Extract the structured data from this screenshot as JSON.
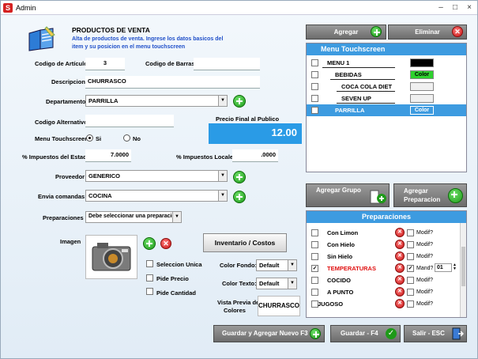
{
  "window": {
    "title": "Admin",
    "min": "–",
    "max": "□",
    "close": "×"
  },
  "header": {
    "title": "PRODUCTOS DE VENTA",
    "subtitle_line1": "Alta de productos de venta. Ingrese los datos basicos del",
    "subtitle_line2": "item y su posicion en el menu touchscreen"
  },
  "form": {
    "codigo_articulo_label": "Codigo de Artículo",
    "codigo_articulo_value": "3",
    "codigo_barras_label": "Codigo de Barras",
    "codigo_barras_value": "",
    "descripcion_label": "Descripcion",
    "descripcion_value": "CHURRASCO",
    "departamento_label": "Departamento",
    "departamento_value": "PARRILLA",
    "codigo_alternativo_label": "Codigo Alternativo",
    "codigo_alternativo_value": "",
    "precio_label": "Precio Final al Publico",
    "precio_value": "12.00",
    "menu_touch_label": "Menu Touchscreen",
    "si_label": "Si",
    "no_label": "No",
    "impuestos_estado_label": "% Impuestos del Estado",
    "impuestos_estado_value": "7.0000",
    "impuestos_locales_label": "% Impuestos Locales",
    "impuestos_locales_value": ".0000",
    "proveedor_label": "Proveedor",
    "proveedor_value": "GENERICO",
    "envia_label": "Envia comandas a",
    "envia_value": "COCINA",
    "preparaciones_label": "Preparaciones",
    "preparaciones_value": "Debe seleccionar una preparacion",
    "imagen_label": "Imagen",
    "inventario_button": "Inventario / Costos",
    "seleccion_unica": "Seleccion Unica",
    "pide_precio": "Pide Precio",
    "pide_cantidad": "Pide Cantidad",
    "color_fondo_label": "Color Fondo:",
    "color_fondo_value": "Default",
    "color_texto_label": "Color Texto:",
    "color_texto_value": "Default",
    "vista_label_1": "Vista Previa de",
    "vista_label_2": "Colores",
    "vista_value": "CHURRASCO"
  },
  "menu_panel": {
    "agregar": "Agregar",
    "eliminar": "Eliminar",
    "title": "Menu Touchscreen",
    "items": [
      {
        "label": "MENU 1",
        "checked": false,
        "swatch": "",
        "swatch_color": "#000000"
      },
      {
        "label": "BEBIDAS",
        "checked": false,
        "swatch": "Color",
        "swatch_color": "#2ed12e"
      },
      {
        "label": "COCA COLA DIET",
        "checked": false,
        "swatch": "",
        "swatch_color": "#f0f0f0"
      },
      {
        "label": "SEVEN UP",
        "checked": false,
        "swatch": "",
        "swatch_color": "#f0f0f0"
      },
      {
        "label": "PARRILLA",
        "checked": true,
        "swatch": "Color",
        "swatch_color": "#3d9be0"
      }
    ],
    "check_mark": "✓"
  },
  "prep_panel": {
    "agregar_grupo": "Agregar Grupo",
    "agregar_prep_1": "Agregar",
    "agregar_prep_2": "Preparacion",
    "title": "Preparaciones",
    "items": [
      {
        "label": "Con Limon",
        "checked": false,
        "red": false,
        "modif": "Modif?"
      },
      {
        "label": "Con Hielo",
        "checked": false,
        "red": false,
        "modif": "Modif?"
      },
      {
        "label": "Sin Hielo",
        "checked": false,
        "red": false,
        "modif": "Modif?"
      },
      {
        "label": "TEMPERATURAS",
        "checked": true,
        "red": true,
        "modif": "Mand?",
        "qty": "01"
      },
      {
        "label": "COCIDO",
        "checked": false,
        "red": false,
        "modif": "Modif?"
      },
      {
        "label": "A PUNTO",
        "checked": false,
        "red": false,
        "modif": "Modif?"
      },
      {
        "label": "JUGOSO",
        "checked": false,
        "red": false,
        "modif": "Modif?"
      }
    ]
  },
  "footer": {
    "guardar_nuevo": "Guardar y Agregar Nuevo F3",
    "guardar": "Guardar - F4",
    "salir": "Salir - ESC"
  }
}
